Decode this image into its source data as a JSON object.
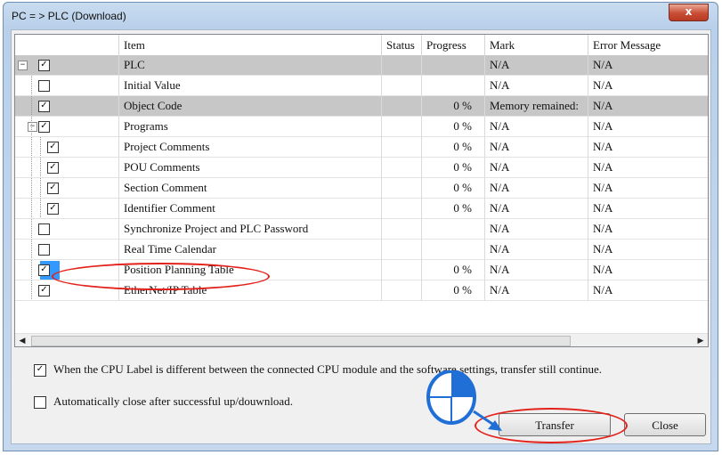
{
  "window": {
    "title": "PC = > PLC (Download)",
    "close_glyph": "x"
  },
  "table": {
    "columns": [
      "Item",
      "Status",
      "Progress",
      "Mark",
      "Error Message"
    ],
    "rows": [
      {
        "item": "PLC",
        "status": "",
        "progress": "",
        "mark": "N/A",
        "error": "N/A",
        "checked": true,
        "level": 0,
        "toggle": "−",
        "highlight": true
      },
      {
        "item": "Initial Value",
        "status": "",
        "progress": "",
        "mark": "N/A",
        "error": "N/A",
        "checked": false,
        "level": 1
      },
      {
        "item": "Object Code",
        "status": "",
        "progress": "0 %",
        "mark": "Memory remained:",
        "error": "N/A",
        "checked": true,
        "level": 1,
        "highlight": true
      },
      {
        "item": "Programs",
        "status": "",
        "progress": "0 %",
        "mark": "N/A",
        "error": "N/A",
        "checked": true,
        "level": 1,
        "toggle": "−"
      },
      {
        "item": "Project Comments",
        "status": "",
        "progress": "0 %",
        "mark": "N/A",
        "error": "N/A",
        "checked": true,
        "level": 2
      },
      {
        "item": "POU Comments",
        "status": "",
        "progress": "0 %",
        "mark": "N/A",
        "error": "N/A",
        "checked": true,
        "level": 2
      },
      {
        "item": "Section Comment",
        "status": "",
        "progress": "0 %",
        "mark": "N/A",
        "error": "N/A",
        "checked": true,
        "level": 2
      },
      {
        "item": "Identifier Comment",
        "status": "",
        "progress": "0 %",
        "mark": "N/A",
        "error": "N/A",
        "checked": true,
        "level": 2
      },
      {
        "item": "Synchronize Project and PLC Password",
        "status": "",
        "progress": "",
        "mark": "N/A",
        "error": "N/A",
        "checked": false,
        "level": 1
      },
      {
        "item": "Real Time Calendar",
        "status": "",
        "progress": "",
        "mark": "N/A",
        "error": "N/A",
        "checked": false,
        "level": 1
      },
      {
        "item": "Position Planning Table",
        "status": "",
        "progress": "0 %",
        "mark": "N/A",
        "error": "N/A",
        "checked": true,
        "level": 1,
        "selected": true
      },
      {
        "item": "EtherNet/IP Table",
        "status": "",
        "progress": "0 %",
        "mark": "N/A",
        "error": "N/A",
        "checked": true,
        "level": 1
      }
    ]
  },
  "scrollbar": {
    "left_arrow": "◀",
    "right_arrow": "▶"
  },
  "options": {
    "cpu_label_text": "When the CPU Label is different between the connected CPU module and the software settings, transfer still continue.",
    "cpu_label_checked": true,
    "auto_close_text": "Automatically close after successful up/douwnload.",
    "auto_close_checked": false
  },
  "buttons": {
    "transfer": "Transfer",
    "close": "Close"
  },
  "colors": {
    "annotation": "#e3211b",
    "pointer": "#1f6fd6",
    "selection": "#3399ff"
  }
}
